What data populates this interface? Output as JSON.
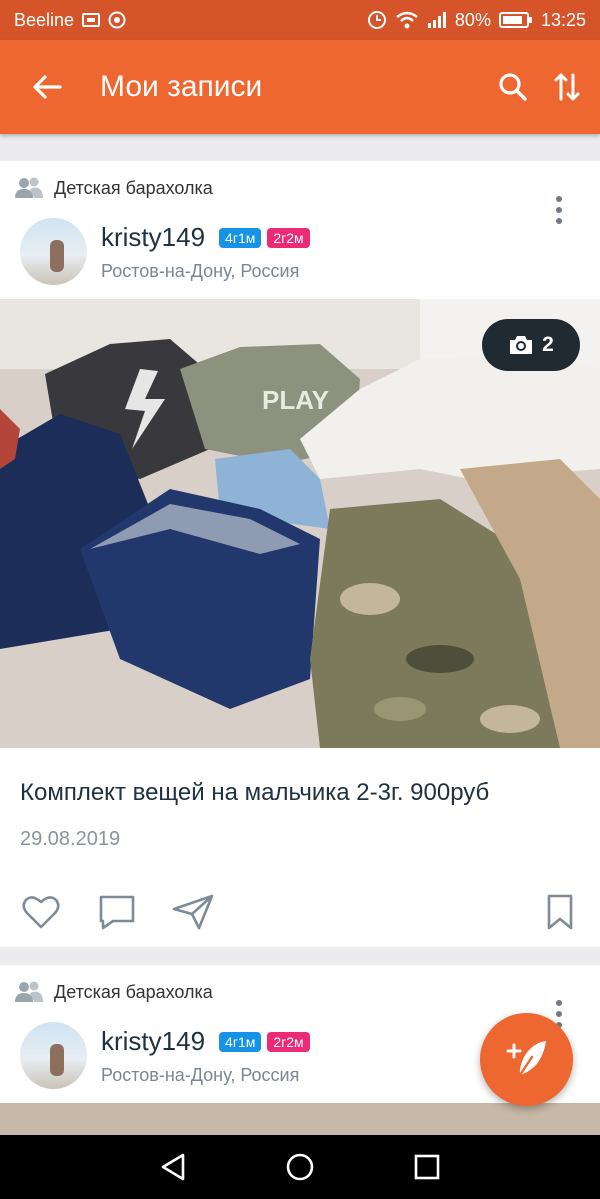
{
  "status_bar": {
    "carrier": "Beeline",
    "battery": "80%",
    "time": "13:25",
    "icons": [
      "sim-card-icon",
      "chrome-icon",
      "alarm-icon",
      "wifi-icon",
      "signal-icon",
      "battery-icon"
    ]
  },
  "header": {
    "title": "Мои записи",
    "back_icon": "arrow-left-icon",
    "actions": [
      "search-icon",
      "sort-arrows-icon"
    ]
  },
  "posts": [
    {
      "group": "Детская барахолка",
      "author": "kristy149",
      "badges": [
        {
          "label": "4г1м",
          "color": "#1593e6"
        },
        {
          "label": "2г2м",
          "color": "#ec2a76"
        }
      ],
      "location": "Ростов-на-Дону, Россия",
      "photo_count": "2",
      "text": "Комплект вещей на мальчика 2-3г. 900руб",
      "date": "29.08.2019",
      "actions": [
        "heart-icon",
        "comment-icon",
        "share-icon",
        "bookmark-icon"
      ]
    },
    {
      "group": "Детская барахолка",
      "author": "kristy149",
      "badges": [
        {
          "label": "4г1м",
          "color": "#1593e6"
        },
        {
          "label": "2г2м",
          "color": "#ec2a76"
        }
      ],
      "location": "Ростов-на-Дону, Россия"
    }
  ],
  "fab": {
    "icon": "feather-plus-icon"
  },
  "nav": [
    "back-triangle-icon",
    "home-circle-icon",
    "recents-square-icon"
  ],
  "colors": {
    "accent": "#ee6630",
    "status_bar": "#d5542a",
    "badge_blue": "#1593e6",
    "badge_pink": "#ec2a76"
  }
}
